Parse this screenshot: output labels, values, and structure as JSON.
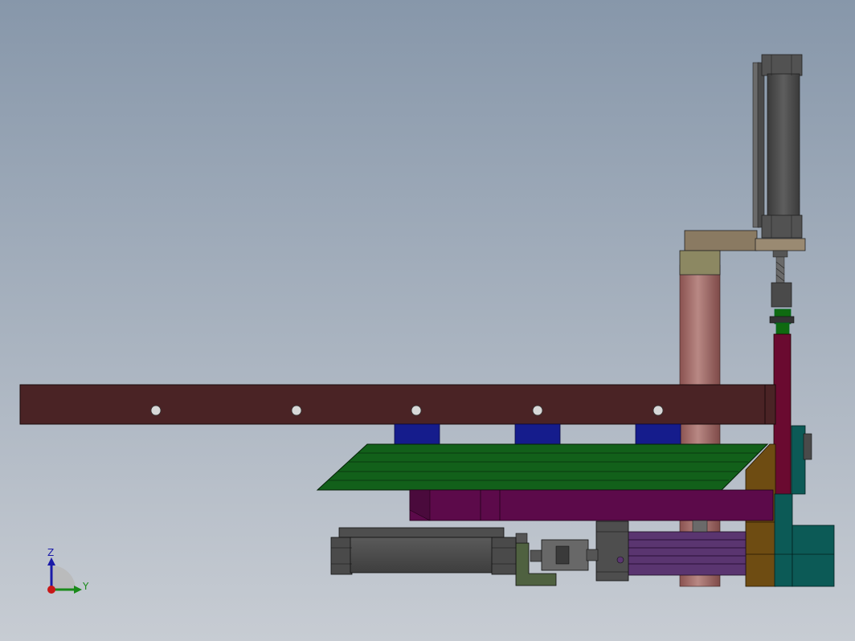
{
  "triad": {
    "z_label": "Z",
    "y_label": "Y",
    "z_color": "#1a1aa8",
    "y_color": "#1a8a1a",
    "x_color": "#c81818"
  },
  "colors": {
    "bg_top": "#8998ab",
    "bg_bottom": "#c6cbd2",
    "beam": "#4a2325",
    "hole": "#d8d8d8",
    "pad_blue": "#151c8c",
    "plate_green": "#12601a",
    "plate_green_line": "#1c7a24",
    "bar_purple": "#5c0a4a",
    "slide_purple": "#5a3570",
    "column_pink": "#a56e6a",
    "cylinder_gray": "#4e4e4e",
    "bracket_olive": "#4f6140",
    "coupling_gray": "#686868",
    "teal_block": "#0c5a56",
    "ochre_block": "#6e4c12",
    "tan_plate": "#8a7a62",
    "khaki_block": "#8a8660",
    "maroon_post": "#6a0a30",
    "small_green": "#0f6a10"
  }
}
